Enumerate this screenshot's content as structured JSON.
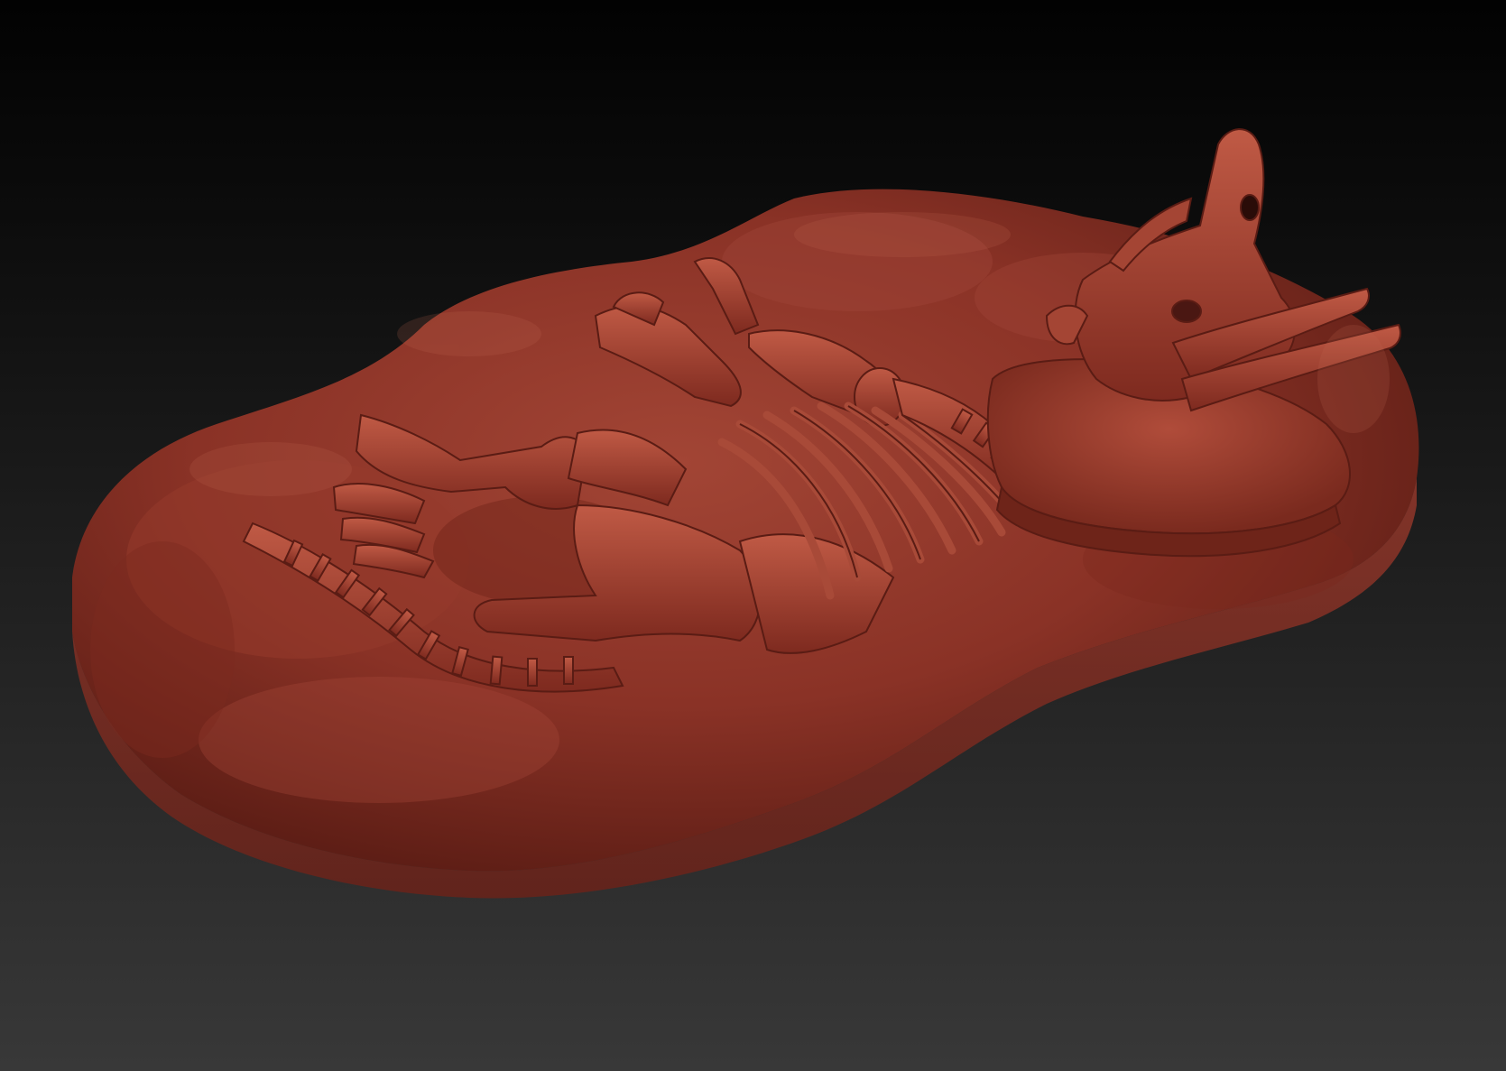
{
  "viewport": {
    "label": "",
    "background_top": "#020202",
    "background_bottom": "#383838"
  },
  "model": {
    "subject": "fossil-skeleton-in-rock-slab",
    "material_color": "#8e3327",
    "highlight_color": "#b8523f",
    "shadow_color": "#4a1712"
  }
}
